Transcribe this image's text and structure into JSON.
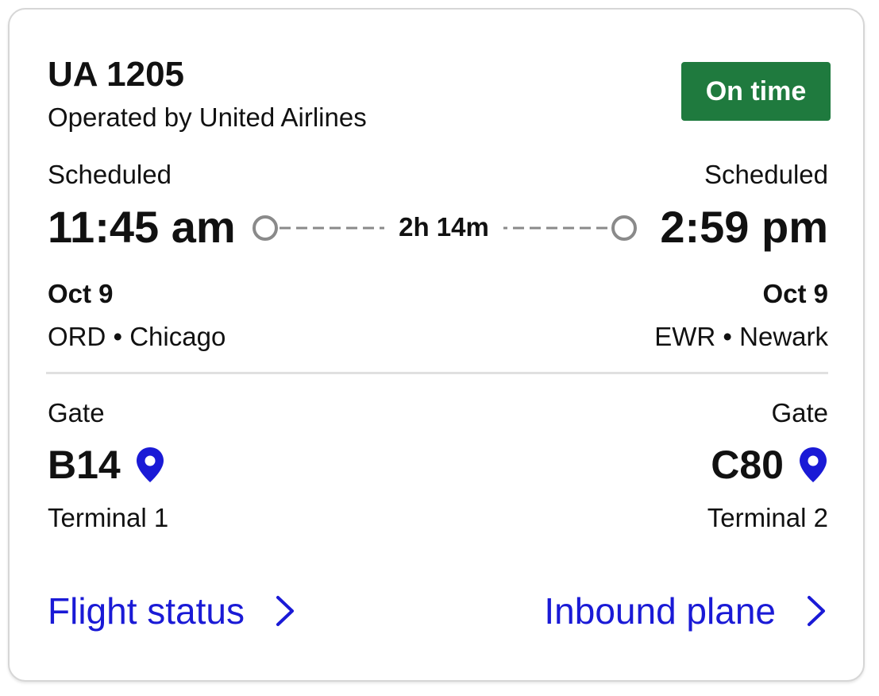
{
  "flight": {
    "number": "UA 1205",
    "operator": "Operated by United Airlines",
    "status": "On time",
    "status_color": "#1f7a3e"
  },
  "departure": {
    "label": "Scheduled",
    "time": "11:45 am",
    "date": "Oct 9",
    "airport": "ORD • Chicago",
    "gate_label": "Gate",
    "gate": "B14",
    "terminal": "Terminal 1"
  },
  "arrival": {
    "label": "Scheduled",
    "time": "2:59 pm",
    "date": "Oct 9",
    "airport": "EWR • Newark",
    "gate_label": "Gate",
    "gate": "C80",
    "terminal": "Terminal 2"
  },
  "duration": "2h 14m",
  "links": {
    "flight_status": "Flight status",
    "inbound_plane": "Inbound plane",
    "link_color": "#1a1ad6"
  },
  "icons": {
    "gate_pin": "map-pin-icon",
    "chevron": "chevron-right-icon"
  }
}
